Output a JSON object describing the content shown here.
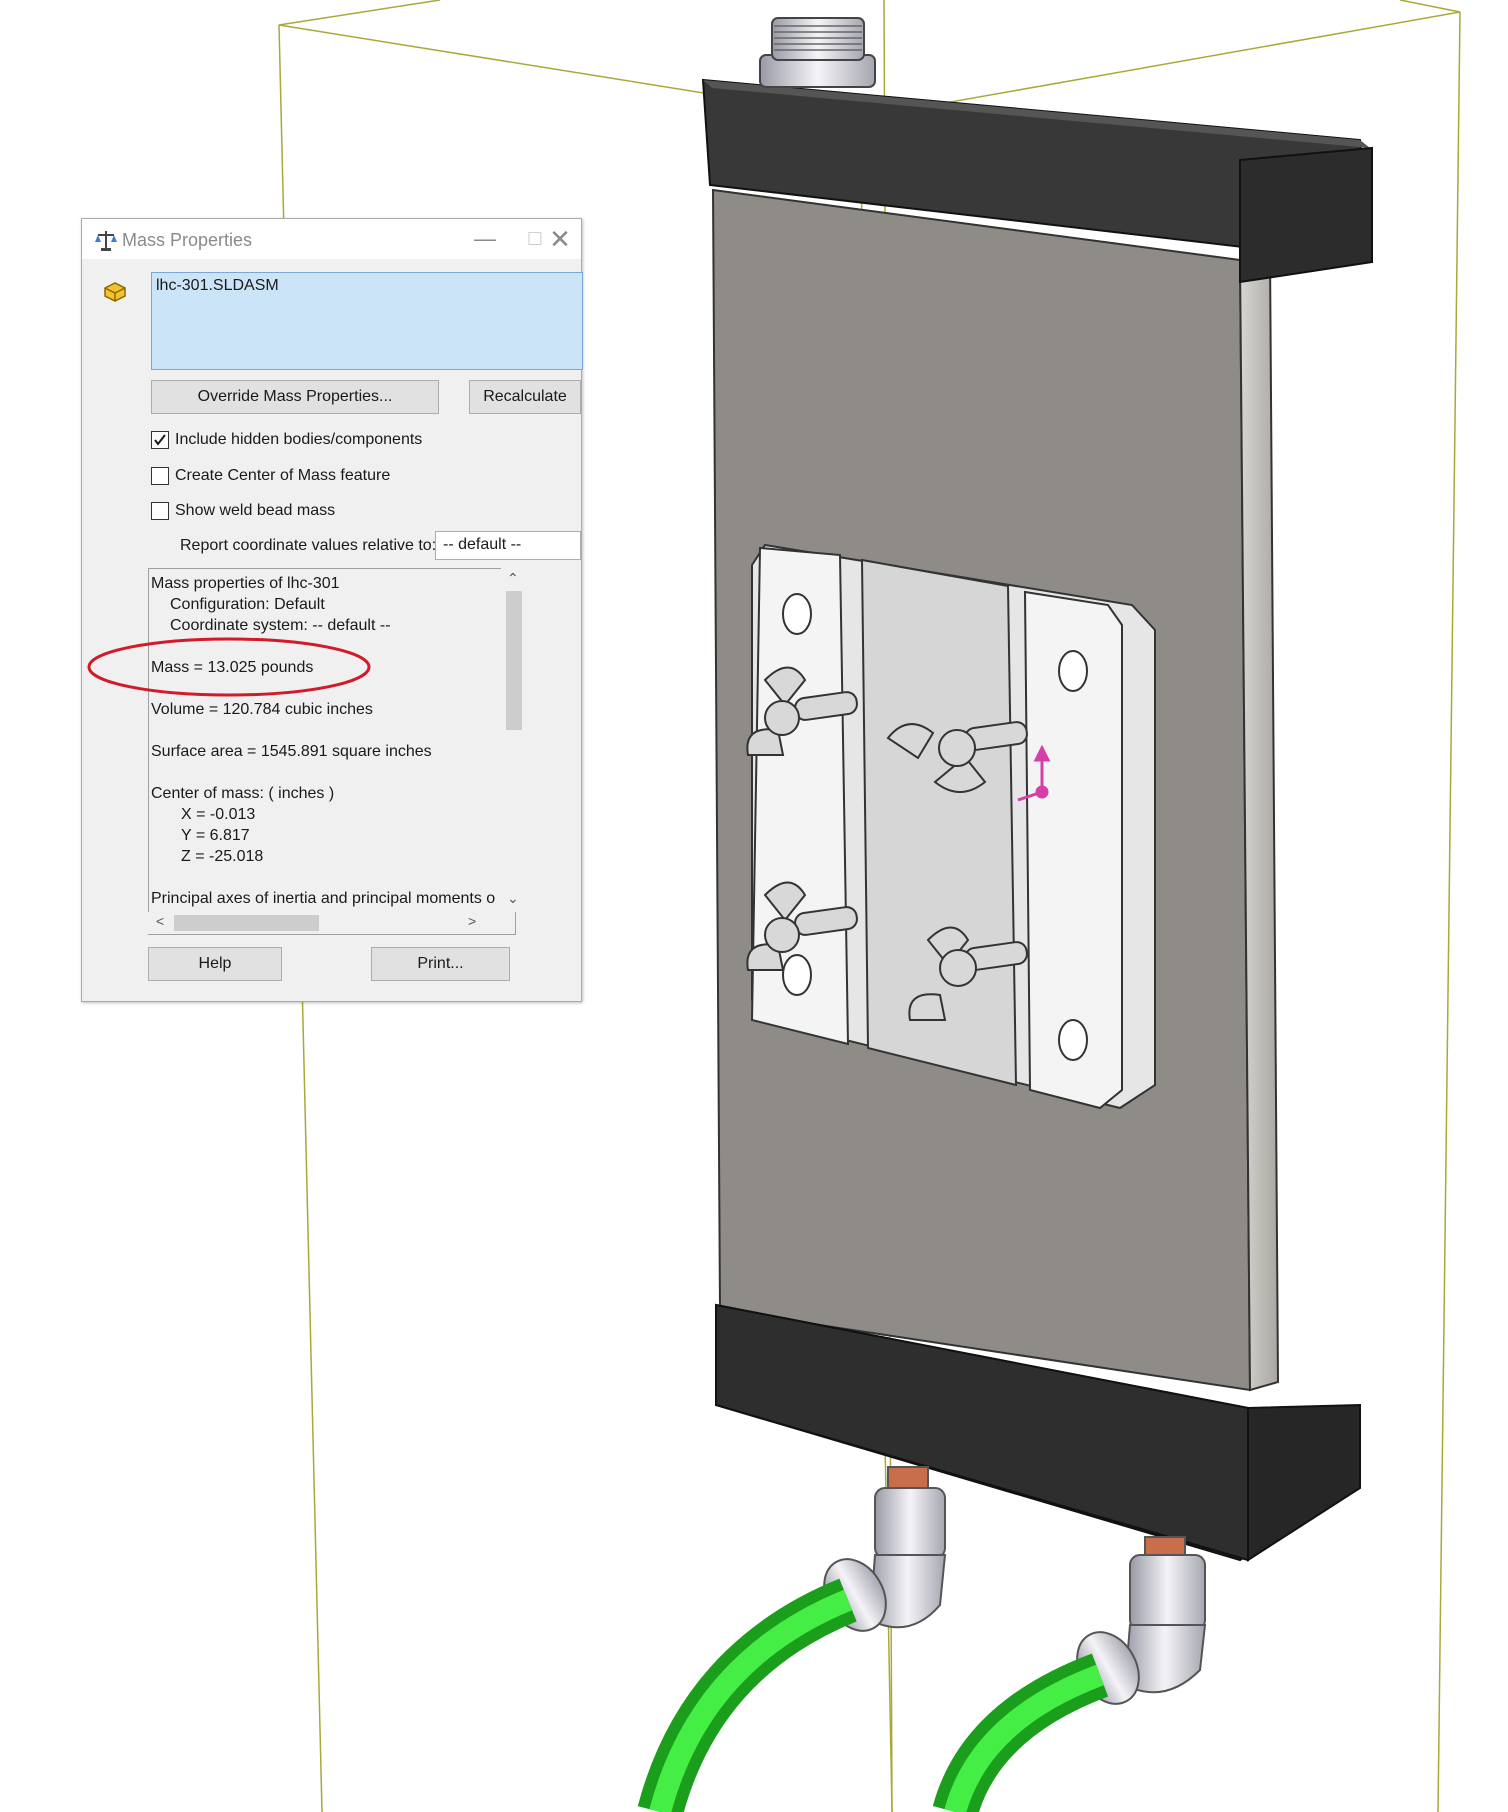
{
  "dialog": {
    "title": "Mass Properties",
    "selection_item": "lhc-301.SLDASM",
    "override_button": "Override Mass Properties...",
    "recalculate_button": "Recalculate",
    "checkboxes": [
      {
        "label": "Include hidden bodies/components",
        "checked": true
      },
      {
        "label": "Create Center of Mass feature",
        "checked": false
      },
      {
        "label": "Show weld bead mass",
        "checked": false
      }
    ],
    "coord_label": "Report coordinate values relative to:",
    "coord_value": "-- default --",
    "results": {
      "heading": "Mass properties of lhc-301",
      "configuration": "Configuration: Default",
      "coordinate_system": "Coordinate system: -- default --",
      "mass": "Mass = 13.025 pounds",
      "volume": "Volume = 120.784 cubic inches",
      "surface_area": "Surface area = 1545.891 square inches",
      "center_of_mass": "Center of mass: ( inches )",
      "x": "X = -0.013",
      "y": "Y = 6.817",
      "z": "Z = -25.018",
      "principal": "Principal axes of inertia and principal moments o"
    },
    "help_button": "Help",
    "print_button": "Print..."
  },
  "colors": {
    "highlight_ellipse": "#d11a2a",
    "hose": "#2fdc2f",
    "housing": "#8f8b86",
    "end_cap": "#353535"
  }
}
